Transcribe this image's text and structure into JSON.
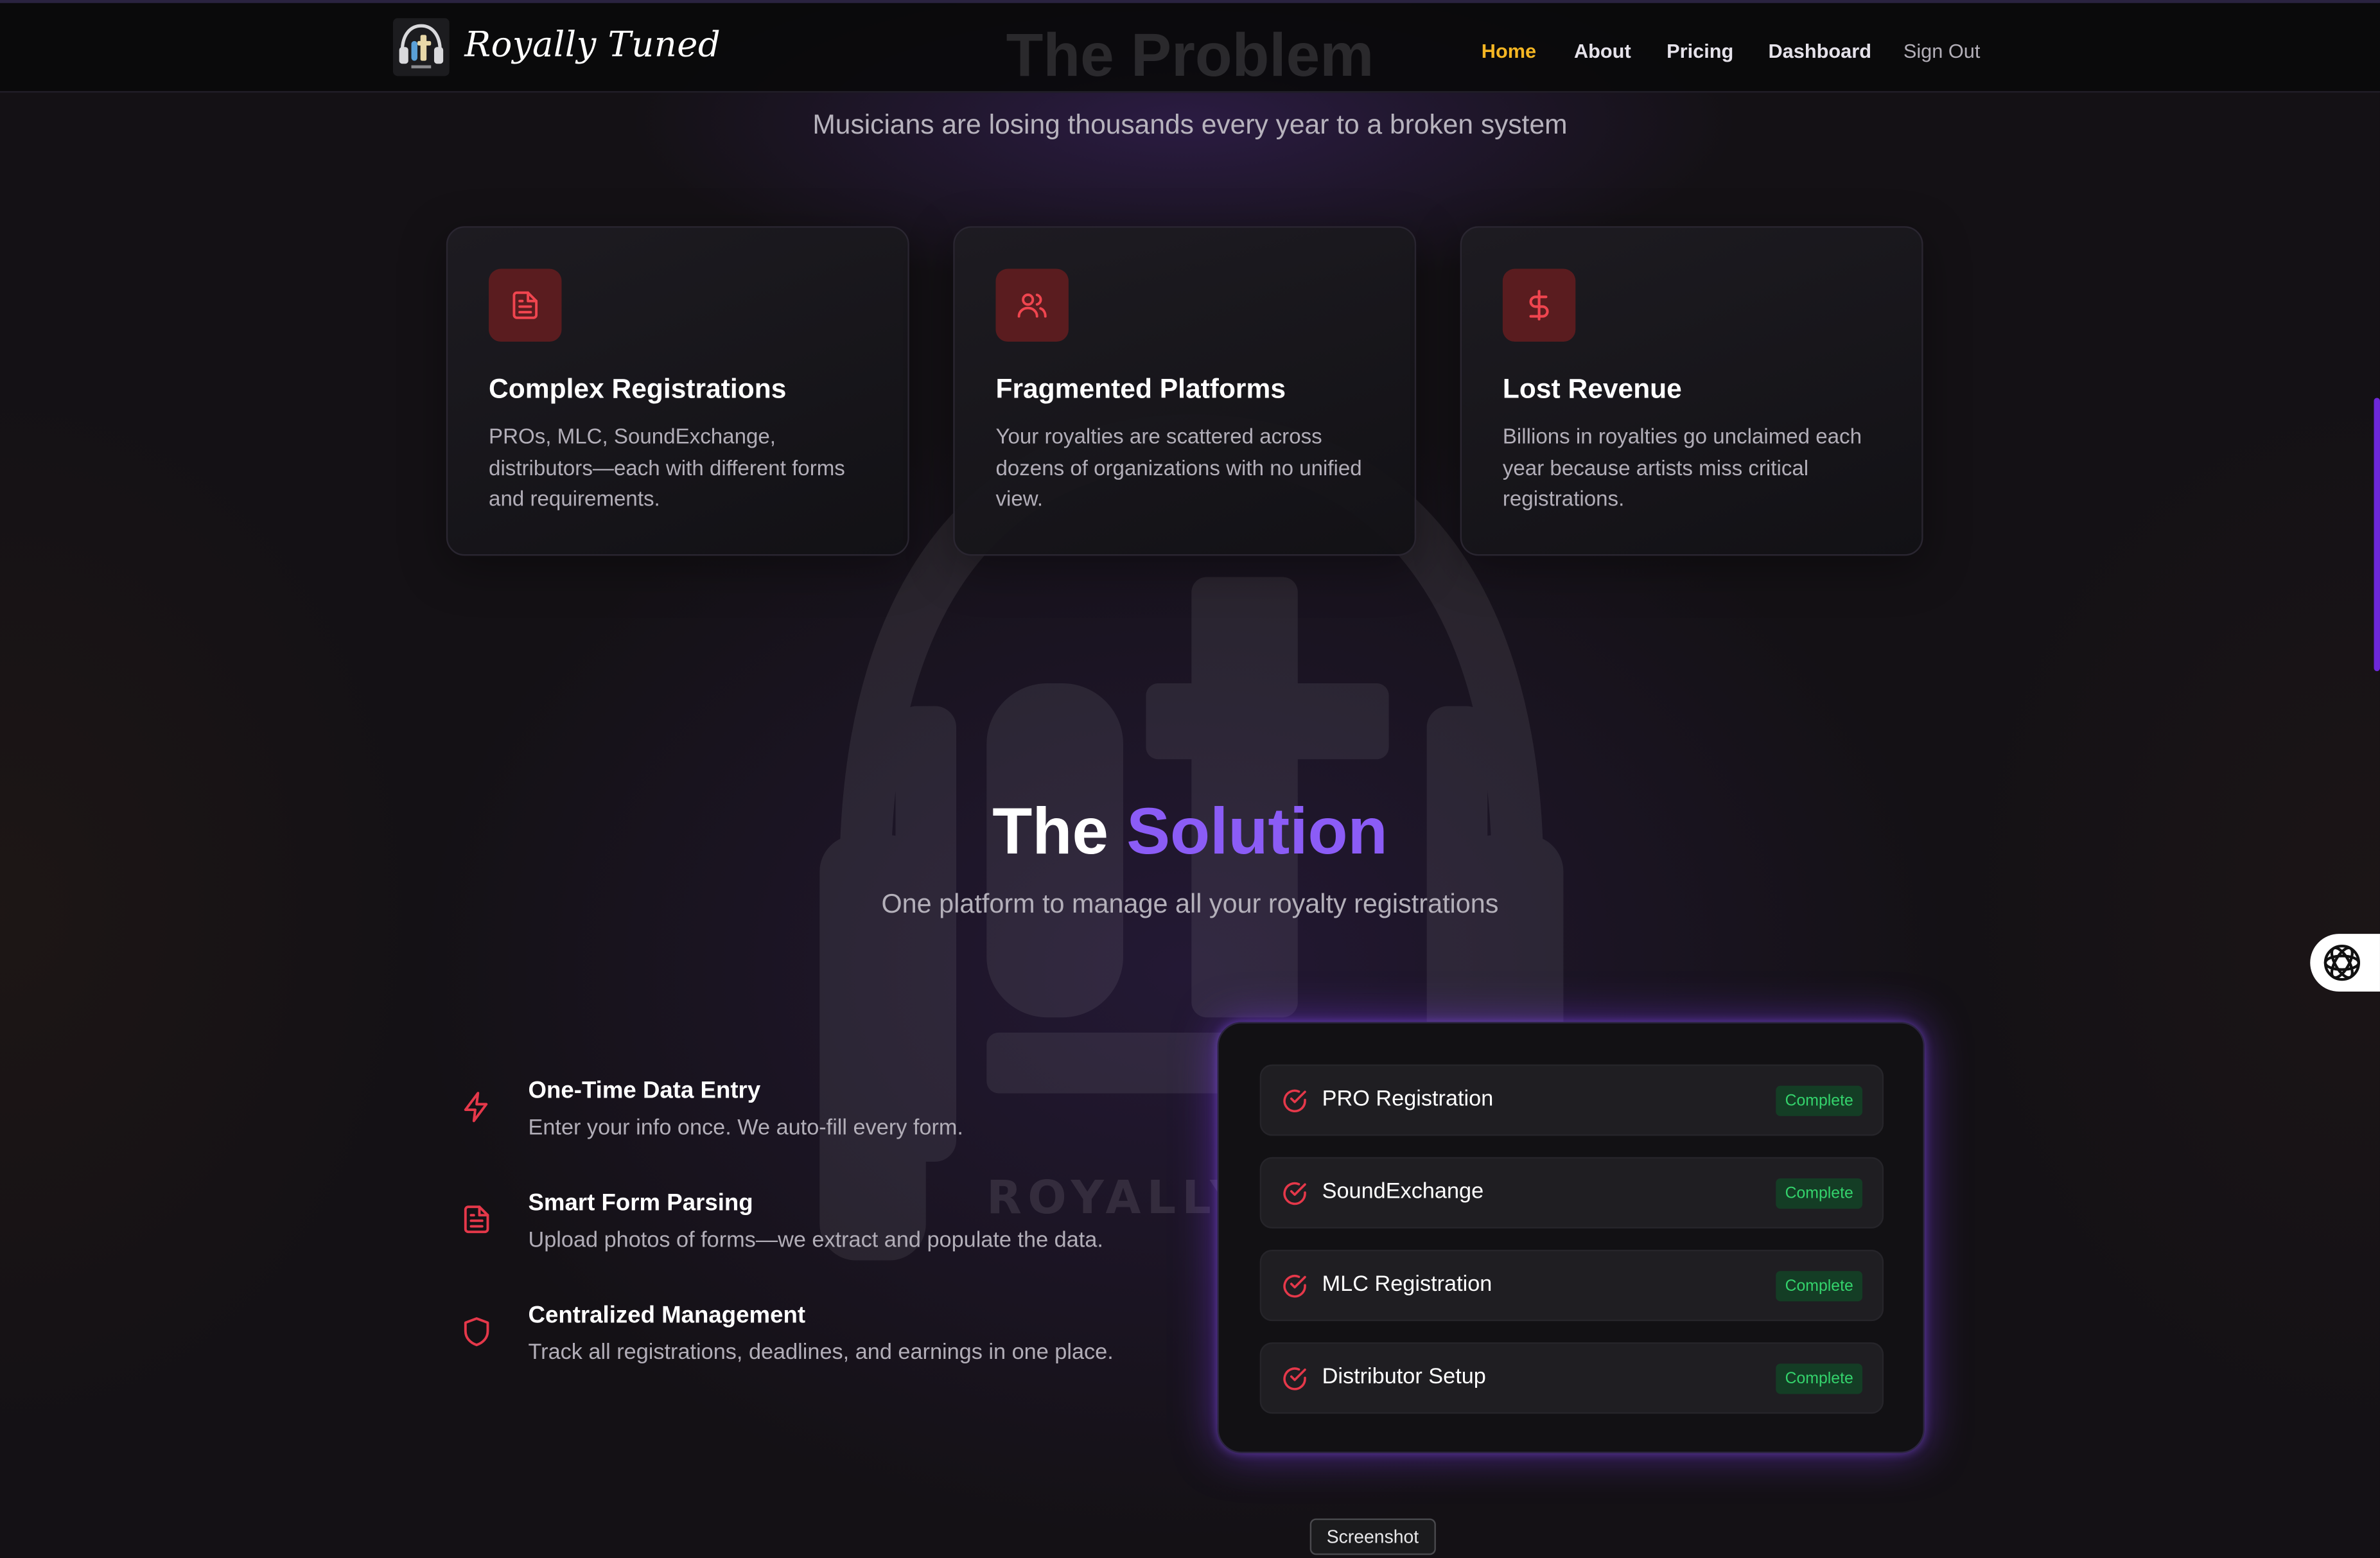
{
  "brand": {
    "name": "Royally Tuned",
    "logo_icon": "headphones-rt-logo"
  },
  "nav": {
    "items": [
      {
        "label": "Home",
        "active": true
      },
      {
        "label": "About"
      },
      {
        "label": "Pricing"
      },
      {
        "label": "Dashboard"
      },
      {
        "label": "Sign Out"
      }
    ],
    "active_color": "#f5b623"
  },
  "problem": {
    "title": "The Problem",
    "subtitle": "Musicians are losing thousands every year to a broken system",
    "cards": [
      {
        "icon": "document-icon",
        "title": "Complex Registrations",
        "text": "PROs, MLC, SoundExchange, distributors—each with different forms and requirements."
      },
      {
        "icon": "users-icon",
        "title": "Fragmented Platforms",
        "text": "Your royalties are scattered across dozens of organizations with no unified view."
      },
      {
        "icon": "dollar-icon",
        "title": "Lost Revenue",
        "text": "Billions in royalties go unclaimed each year because artists miss critical registrations."
      }
    ]
  },
  "solution": {
    "title_prefix": "The",
    "title_accent": "Solution",
    "subtitle": "One platform to manage all your royalty registrations",
    "accent_color": "#8b5cf6",
    "features": [
      {
        "icon": "lightning-icon",
        "title": "One-Time Data Entry",
        "text": "Enter your info once. We auto-fill every form."
      },
      {
        "icon": "document-icon",
        "title": "Smart Form Parsing",
        "text": "Upload photos of forms—we extract and populate the data."
      },
      {
        "icon": "shield-icon",
        "title": "Centralized Management",
        "text": "Track all registrations, deadlines, and earnings in one place."
      }
    ],
    "status_items": [
      {
        "label": "PRO Registration",
        "status": "Complete"
      },
      {
        "label": "SoundExchange",
        "status": "Complete"
      },
      {
        "label": "MLC Registration",
        "status": "Complete"
      },
      {
        "label": "Distributor Setup",
        "status": "Complete"
      }
    ],
    "status_color": "#34d36c"
  },
  "watermark_text": "ROYALLY",
  "tooltip": "Screenshot",
  "side_widget_icon": "openai-icon"
}
